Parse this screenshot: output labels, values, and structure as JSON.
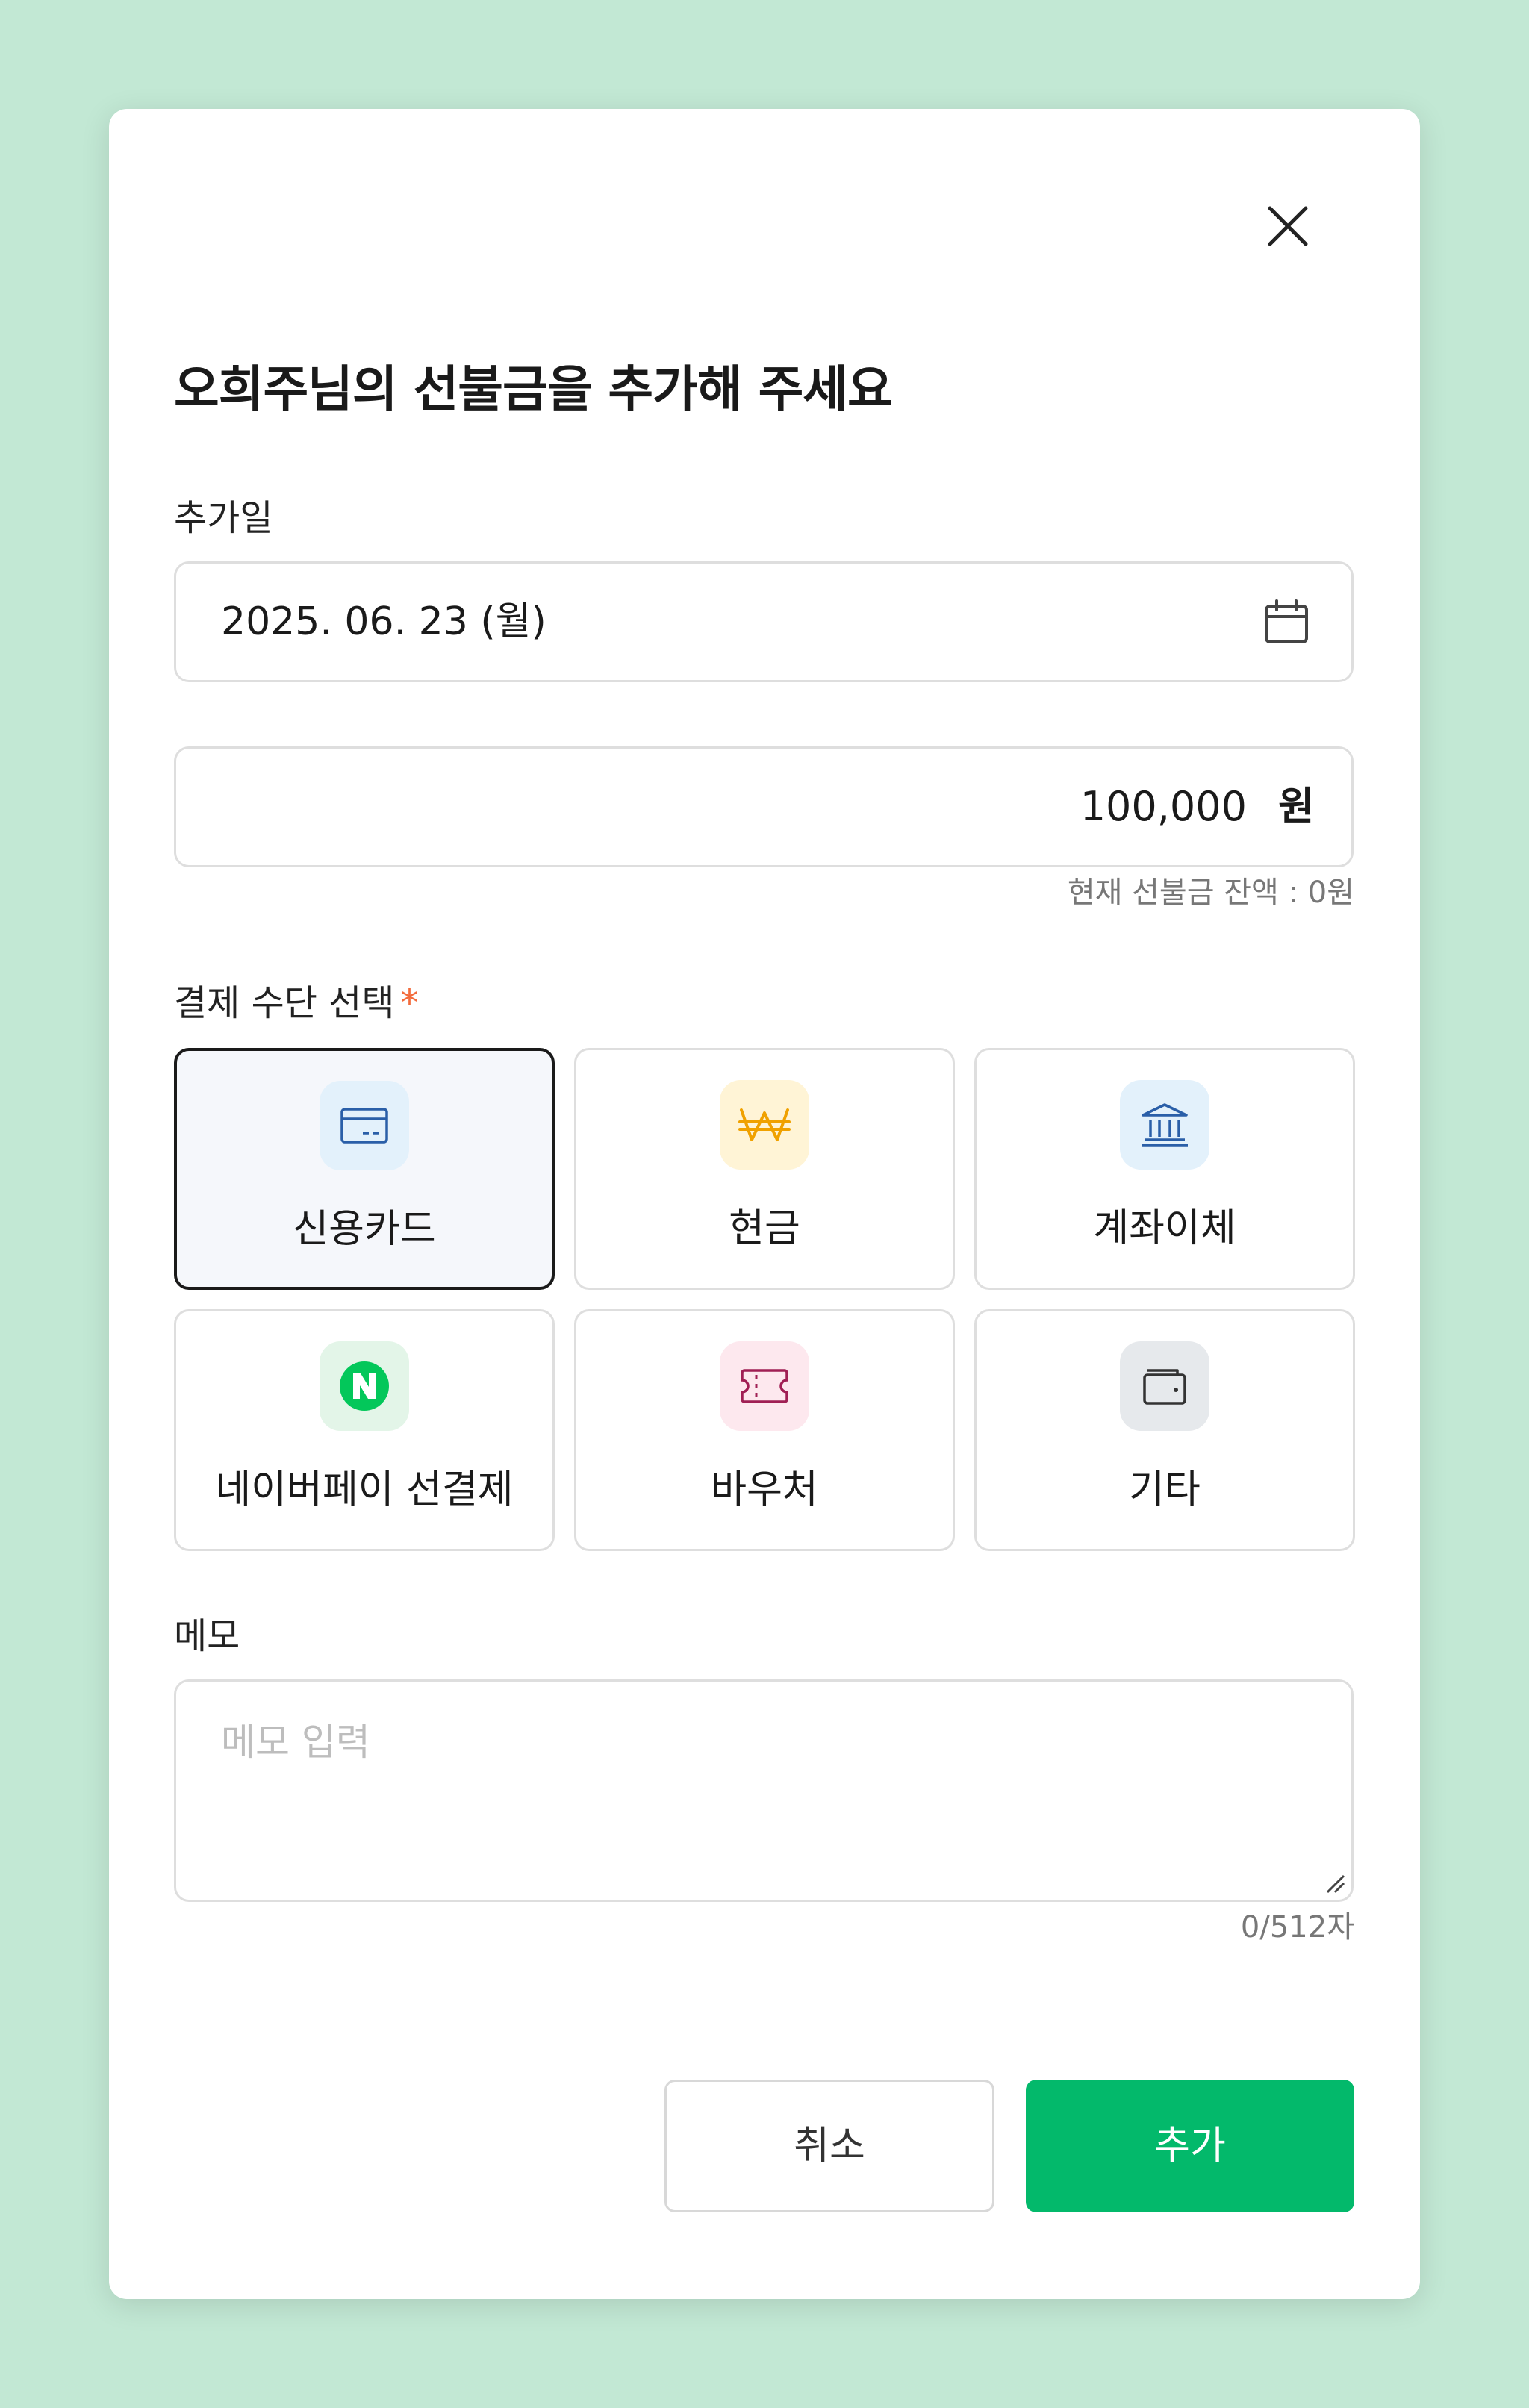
{
  "modal": {
    "title": "오희주님의 선불금을 추가해 주세요",
    "close_icon": "close-icon"
  },
  "date": {
    "label": "추가일",
    "value": "2025. 06. 23 (월)",
    "icon": "calendar-icon"
  },
  "amount": {
    "value": "100,000",
    "unit": "원",
    "balance_helper": "현재 선불금 잔액 : 0원"
  },
  "payment": {
    "label": "결제 수단 선택",
    "required_mark": "*",
    "selected": "신용카드",
    "methods": [
      {
        "label": "신용카드",
        "icon": "credit-card-icon",
        "icon_bg": "#e3f1fb",
        "icon_color": "#2a5fa8"
      },
      {
        "label": "현금",
        "icon": "won-icon",
        "icon_bg": "#fff4d6",
        "icon_color": "#f0a100"
      },
      {
        "label": "계좌이체",
        "icon": "bank-icon",
        "icon_bg": "#e3f1fb",
        "icon_color": "#2a5fa8"
      },
      {
        "label": "네이버페이 선결제",
        "icon": "naver-pay-icon",
        "icon_bg": "#e3f5e8",
        "icon_color": "#03c75a"
      },
      {
        "label": "바우처",
        "icon": "ticket-icon",
        "icon_bg": "#fde8ee",
        "icon_color": "#a01f54"
      },
      {
        "label": "기타",
        "icon": "wallet-icon",
        "icon_bg": "#e6e9ec",
        "icon_color": "#333333"
      }
    ]
  },
  "memo": {
    "label": "메모",
    "placeholder": "메모 입력",
    "counter": "0/512자"
  },
  "buttons": {
    "cancel": "취소",
    "add": "추가"
  },
  "colors": {
    "background": "#c2e8d4",
    "primary": "#03b96b",
    "required": "#f36b3c"
  }
}
